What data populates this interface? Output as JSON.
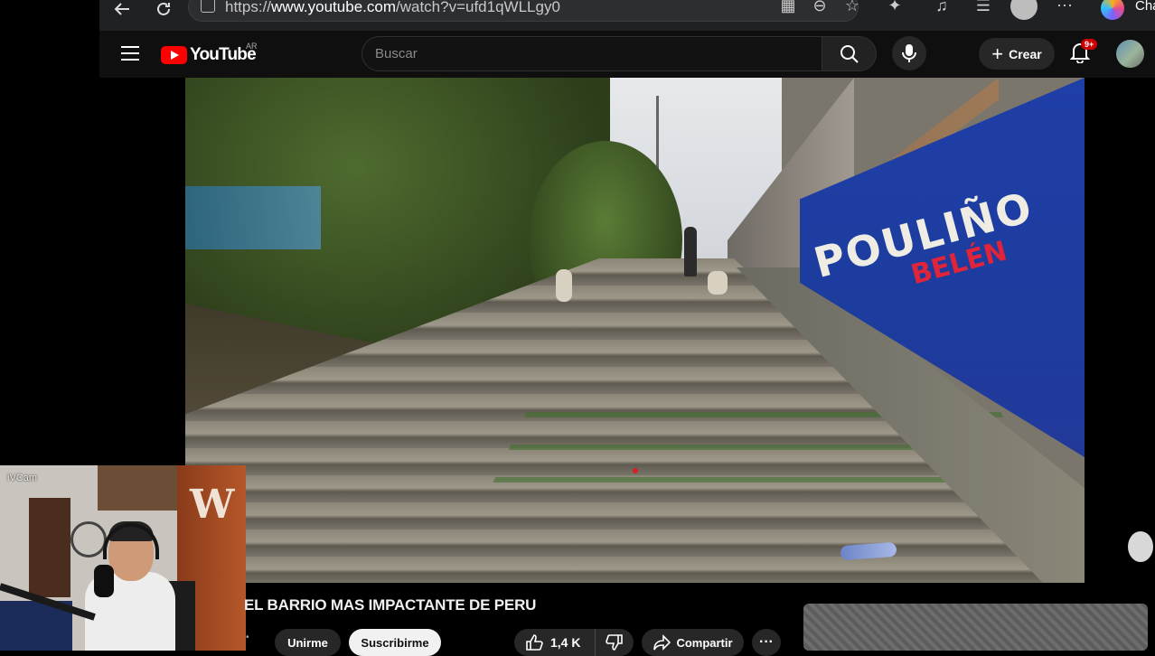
{
  "browser": {
    "url_prefix": "https://",
    "url_host": "www.youtube.com",
    "url_path": "/watch?v=ufd1qWLLgy0",
    "copilot_label": "Cha",
    "icons": [
      "back-icon",
      "reload-icon",
      "site-info-icon",
      "apps-icon",
      "zoom-out-icon",
      "favorite-icon",
      "extensions-icon",
      "media-icon",
      "favorites-collection-icon",
      "profile-icon",
      "more-icon",
      "copilot-icon"
    ]
  },
  "youtube": {
    "logo_text": "YouTube",
    "country_code": "AR",
    "search_placeholder": "Buscar",
    "create_label": "Crear",
    "notifications_badge": "9+"
  },
  "video": {
    "wall_text_main": "POULIÑO",
    "wall_text_sub": "BELÉN",
    "title": "EL BARRIO MAS IMPACTANTE DE PERU"
  },
  "webcam": {
    "label": "iVCam"
  },
  "actions": {
    "join_label": "Unirme",
    "subscribe_label": "Suscribirme",
    "like_count": "1,4 K",
    "share_label": "Compartir",
    "more_label": "···"
  },
  "colors": {
    "yt_red": "#ff0000",
    "background": "#0f0f0f",
    "button_dark": "#272727",
    "subscribe_bg": "#f1f1f1",
    "badge_red": "#cc0000"
  }
}
